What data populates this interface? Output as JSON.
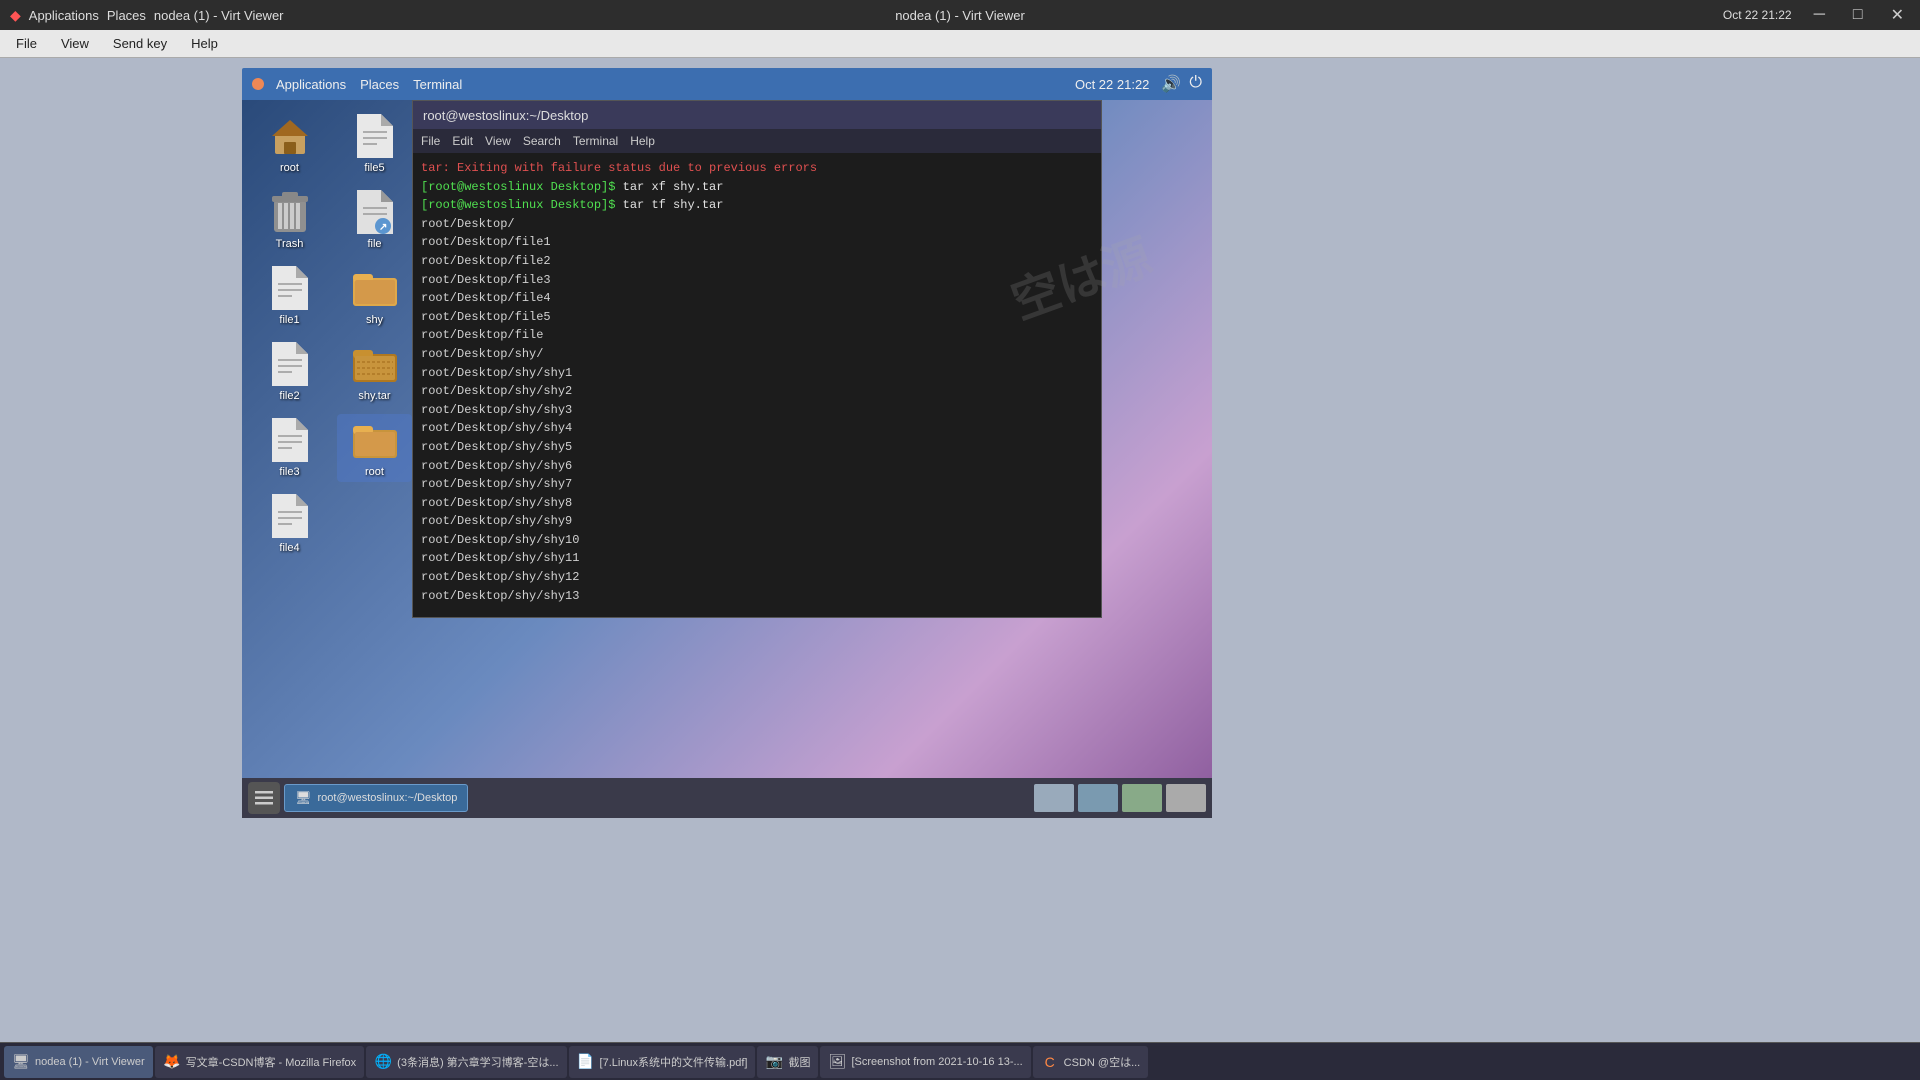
{
  "window": {
    "title": "nodea (1) - Virt Viewer",
    "datetime": "Oct 22  21:22"
  },
  "title_bar": {
    "app_label": "Applications",
    "places_label": "Places",
    "window_title": "nodea (1) - Virt Viewer",
    "datetime": "Oct 22  21:22"
  },
  "menu_bar": {
    "file": "File",
    "view": "View",
    "send_key": "Send key",
    "help": "Help"
  },
  "vm_top_bar": {
    "applications": "Applications",
    "places": "Places",
    "terminal": "Terminal",
    "datetime": "Oct 22  21:22"
  },
  "desktop_icons": [
    {
      "id": "root-home",
      "label": "root",
      "type": "home"
    },
    {
      "id": "file5",
      "label": "file5",
      "type": "file"
    },
    {
      "id": "trash",
      "label": "Trash",
      "type": "trash"
    },
    {
      "id": "file-link",
      "label": "file",
      "type": "file-link"
    },
    {
      "id": "file1",
      "label": "file1",
      "type": "file"
    },
    {
      "id": "shy",
      "label": "shy",
      "type": "folder"
    },
    {
      "id": "file2",
      "label": "file2",
      "type": "file"
    },
    {
      "id": "shy-tar",
      "label": "shy.tar",
      "type": "archive"
    },
    {
      "id": "file3",
      "label": "file3",
      "type": "file"
    },
    {
      "id": "root-folder",
      "label": "root",
      "type": "folder-selected"
    },
    {
      "id": "file4",
      "label": "file4",
      "type": "file"
    }
  ],
  "terminal": {
    "title": "root@westoslinux:~/Desktop",
    "menu": [
      "File",
      "Edit",
      "View",
      "Search",
      "Terminal",
      "Help"
    ],
    "lines": [
      "tar: Exiting with failure status due to previous errors",
      "[root@westoslinux Desktop]$ tar xf shy.tar",
      "[root@westoslinux Desktop]$ tar tf shy.tar",
      "root/Desktop/",
      "root/Desktop/file1",
      "root/Desktop/file2",
      "root/Desktop/file3",
      "root/Desktop/file4",
      "root/Desktop/file5",
      "root/Desktop/file",
      "root/Desktop/shy/",
      "root/Desktop/shy/shy1",
      "root/Desktop/shy/shy2",
      "root/Desktop/shy/shy3",
      "root/Desktop/shy/shy4",
      "root/Desktop/shy/shy5",
      "root/Desktop/shy/shy6",
      "root/Desktop/shy/shy7",
      "root/Desktop/shy/shy8",
      "root/Desktop/shy/shy9",
      "root/Desktop/shy/shy10",
      "root/Desktop/shy/shy11",
      "root/Desktop/shy/shy12",
      "root/Desktop/shy/shy13"
    ]
  },
  "vm_taskbar": {
    "terminal_task": "root@westoslinux:~/Desktop"
  },
  "host_taskbar": {
    "items": [
      {
        "id": "virt-viewer",
        "label": "nodea (1) - Virt Viewer",
        "active": true
      },
      {
        "id": "write-blog",
        "label": "写文章-CSDN博客 - Mozilla Firefox"
      },
      {
        "id": "3-msgs",
        "label": "(3条消息) 第六章学习博客-空は..."
      },
      {
        "id": "linux-pdf",
        "label": "[7.Linux系统中的文件传输.pdf]"
      },
      {
        "id": "screenshot",
        "label": "截图"
      },
      {
        "id": "screenshot2",
        "label": "[Screenshot from 2021-10-16 13-..."
      },
      {
        "id": "csdn",
        "label": "CSDN @空は..."
      }
    ]
  }
}
